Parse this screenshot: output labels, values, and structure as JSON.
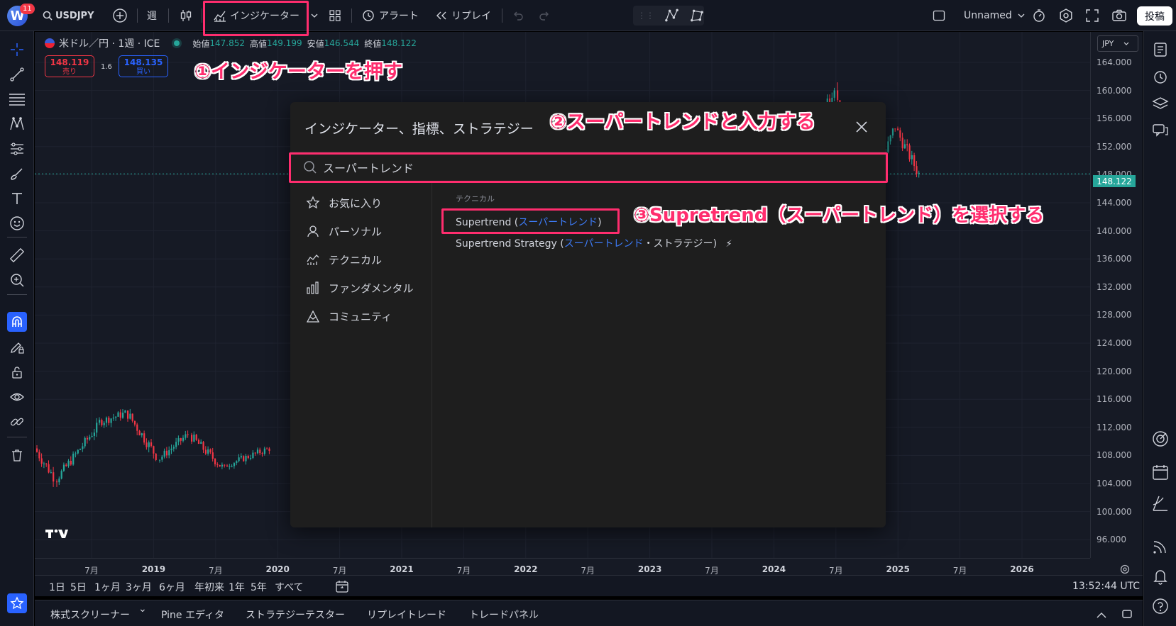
{
  "topbar": {
    "avatar_letter": "W",
    "notif_count": "11",
    "symbol": "USDJPY",
    "interval": "週",
    "indicators_label": "インジケーター",
    "alert_label": "アラート",
    "replay_label": "リプレイ",
    "layout_name": "Unnamed",
    "publish_label": "投稿"
  },
  "legend": {
    "title": "米ドル／円 · 1週 · ICE",
    "open_label": "始値",
    "open": "147.852",
    "high_label": "高値",
    "high": "149.199",
    "low_label": "安値",
    "low": "146.544",
    "close_label": "終値",
    "close": "148.122",
    "sell_price": "148.119",
    "sell_label": "売り",
    "spread": "1.6",
    "buy_price": "148.135",
    "buy_label": "買い"
  },
  "price_scale": {
    "currency": "JPY",
    "ticks": [
      "164.000",
      "160.000",
      "156.000",
      "152.000",
      "148.000",
      "144.000",
      "140.000",
      "136.000",
      "132.000",
      "128.000",
      "124.000",
      "120.000",
      "116.000",
      "112.000",
      "108.000",
      "104.000",
      "100.000",
      "96.000"
    ],
    "current_price": "148.122"
  },
  "time_axis": {
    "ticks": [
      {
        "label": "7月",
        "year": false
      },
      {
        "label": "2019",
        "year": true
      },
      {
        "label": "7月",
        "year": false
      },
      {
        "label": "2020",
        "year": true
      },
      {
        "label": "7月",
        "year": false
      },
      {
        "label": "2021",
        "year": true
      },
      {
        "label": "7月",
        "year": false
      },
      {
        "label": "2022",
        "year": true
      },
      {
        "label": "7月",
        "year": false
      },
      {
        "label": "2023",
        "year": true
      },
      {
        "label": "7月",
        "year": false
      },
      {
        "label": "2024",
        "year": true
      },
      {
        "label": "7月",
        "year": false
      },
      {
        "label": "2025",
        "year": true
      },
      {
        "label": "7月",
        "year": false
      },
      {
        "label": "2026",
        "year": true
      }
    ]
  },
  "ranges": [
    "1日",
    "5日",
    "1ヶ月",
    "3ヶ月",
    "6ヶ月",
    "年初来",
    "1年",
    "5年",
    "すべて"
  ],
  "clock": "13:52:44 UTC",
  "bottom_tabs": [
    "株式スクリーナー",
    "Pine エディタ",
    "ストラテジーテスター",
    "リプレイトレード",
    "トレードパネル"
  ],
  "dialog": {
    "title": "インジケーター、指標、ストラテジー",
    "search_value": "スーパートレンド",
    "categories": [
      "お気に入り",
      "パーソナル",
      "テクニカル",
      "ファンダメンタル",
      "コミュニティ"
    ],
    "results_header": "テクニカル",
    "results": [
      {
        "name": "Supertrend",
        "jp": "スーパートレンド",
        "suffix": ""
      },
      {
        "name": "Supertrend Strategy",
        "jp": "スーパートレンド",
        "suffix": "・ストラテジー"
      }
    ]
  },
  "annotations": {
    "step1": "①インジケーターを押す",
    "step2": "②スーパートレンドと入力する",
    "step3": "③Supretrend（スーパートレンド）を選択する"
  },
  "colors": {
    "accent_pink": "#ff2d6e",
    "up": "#26a69a",
    "down": "#f23645",
    "link_blue": "#3d7bf7"
  }
}
